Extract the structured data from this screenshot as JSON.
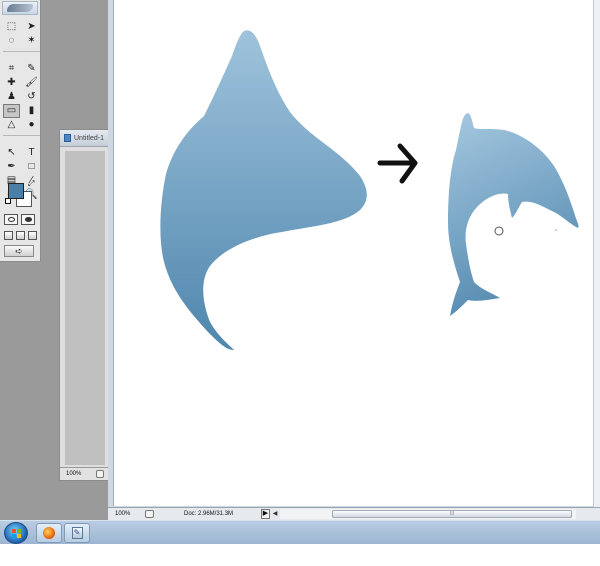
{
  "colors": {
    "foreground": "#4a80a8",
    "background": "#ffffff",
    "shape_light": "#9fc3dc",
    "shape_dark": "#4f86ad",
    "arrow": "#111111"
  },
  "tools": [
    {
      "name": "marquee-tool-icon",
      "glyph": "⬚"
    },
    {
      "name": "move-tool-icon",
      "glyph": "➤"
    },
    {
      "name": "lasso-tool-icon",
      "glyph": "◌"
    },
    {
      "name": "magic-wand-tool-icon",
      "glyph": "✶"
    },
    {
      "name": "crop-tool-icon",
      "glyph": "⌗"
    },
    {
      "name": "slice-tool-icon",
      "glyph": "✎"
    },
    {
      "name": "healing-brush-tool-icon",
      "glyph": "✚"
    },
    {
      "name": "brush-tool-icon",
      "glyph": "🖌"
    },
    {
      "name": "clone-stamp-tool-icon",
      "glyph": "♟"
    },
    {
      "name": "history-brush-tool-icon",
      "glyph": "↺"
    },
    {
      "name": "eraser-tool-icon",
      "glyph": "▭",
      "selected": true
    },
    {
      "name": "gradient-tool-icon",
      "glyph": "▮"
    },
    {
      "name": "blur-tool-icon",
      "glyph": "△"
    },
    {
      "name": "dodge-tool-icon",
      "glyph": "●"
    },
    {
      "name": "path-selection-tool-icon",
      "glyph": "↖"
    },
    {
      "name": "type-tool-icon",
      "glyph": "T"
    },
    {
      "name": "pen-tool-icon",
      "glyph": "✒"
    },
    {
      "name": "shape-tool-icon",
      "glyph": "□"
    },
    {
      "name": "notes-tool-icon",
      "glyph": "▤"
    },
    {
      "name": "eyedropper-tool-icon",
      "glyph": "⁄"
    },
    {
      "name": "hand-tool-icon",
      "glyph": "✋"
    },
    {
      "name": "zoom-tool-icon",
      "glyph": "🔍"
    }
  ],
  "background_window": {
    "title": "Untitled-1",
    "zoom": "100%"
  },
  "status": {
    "zoom": "100%",
    "doc_info": "Doc: 2.96M/31.3M",
    "scroll_grip": "⦙⦙⦙"
  }
}
